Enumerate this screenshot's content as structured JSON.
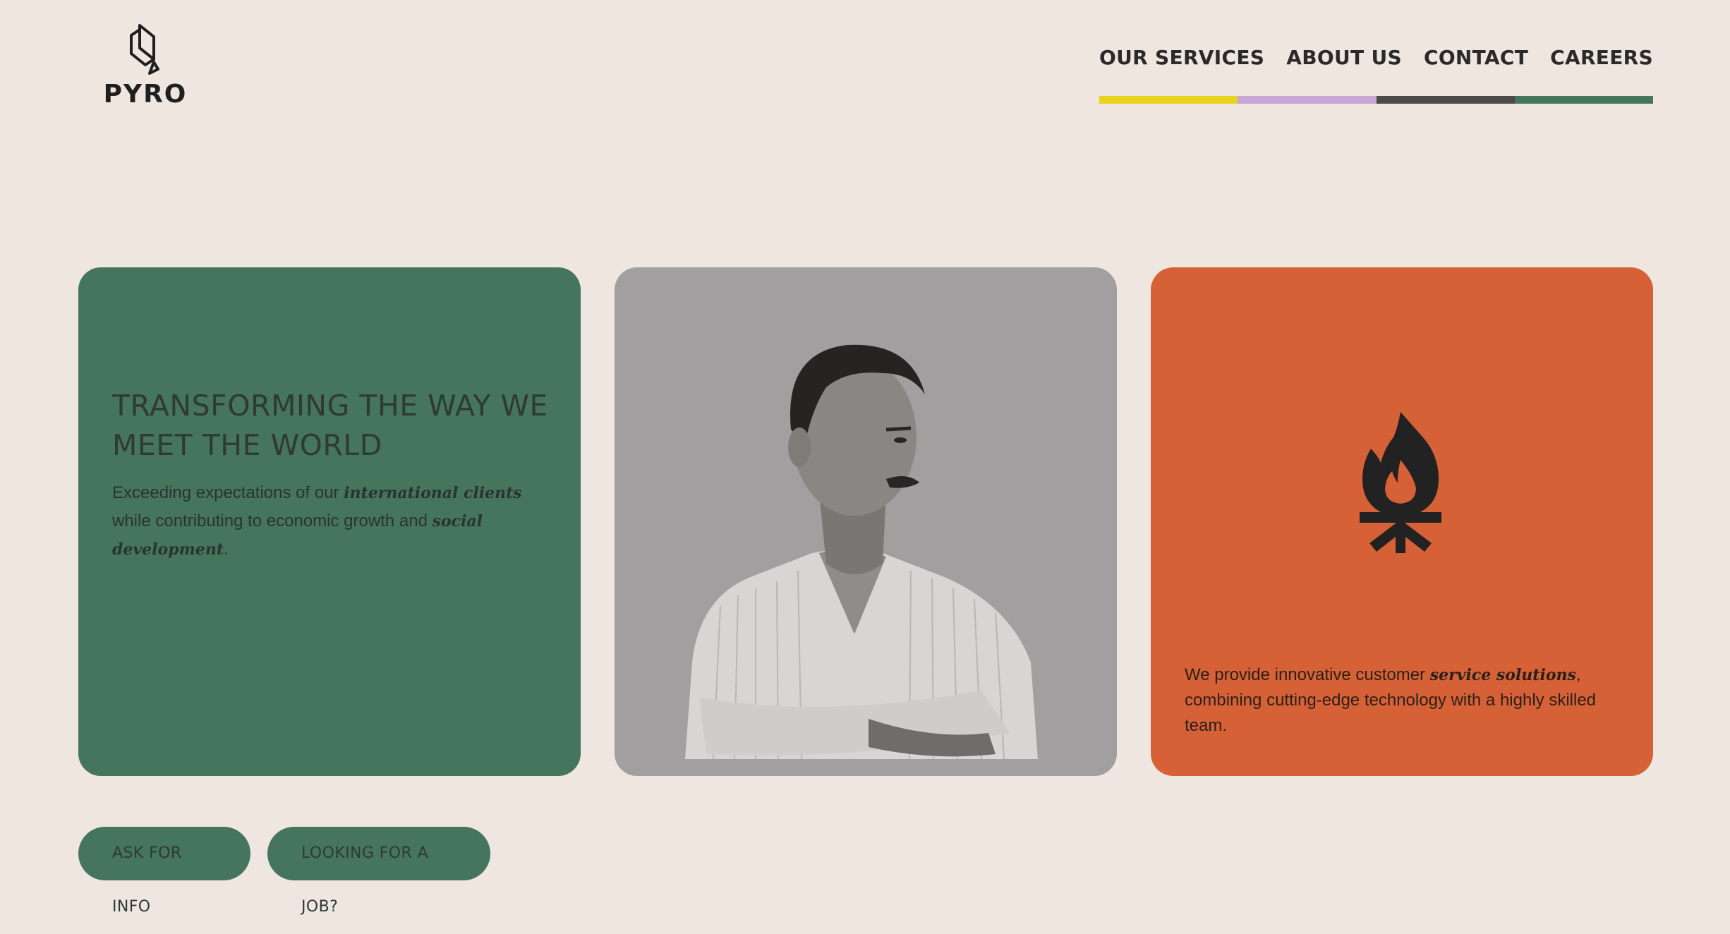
{
  "brand": {
    "name": "PYRO",
    "logo_icon": "pyro-logo-icon"
  },
  "nav": {
    "items": [
      {
        "label": "OUR SERVICES",
        "color": "#e8d31f"
      },
      {
        "label": "ABOUT US",
        "color": "#c9a6d6"
      },
      {
        "label": "CONTACT",
        "color": "#4c4a46"
      },
      {
        "label": "CAREERS",
        "color": "#45755c"
      }
    ]
  },
  "hero": {
    "title": "TRANSFORMING THE WAY WE MEET THE WORLD",
    "text_before": "Exceeding expectations of our ",
    "text_em1": "international clients",
    "text_mid": " while contributing to economic growth and ",
    "text_em2": "social development",
    "text_after": "."
  },
  "photo": {
    "icon": "portrait-image"
  },
  "service": {
    "icon": "campfire-icon",
    "text_before": "We provide innovative customer ",
    "text_em": "service solutions",
    "text_after": ", combining cutting-edge technology with a highly skilled team."
  },
  "buttons": {
    "info": "ASK FOR INFO",
    "job": "LOOKING FOR A JOB?"
  },
  "colors": {
    "background": "#efe6e0",
    "green": "#45755c",
    "photo_bg": "#a19fa0",
    "orange": "#d66136",
    "dark": "#222222"
  }
}
